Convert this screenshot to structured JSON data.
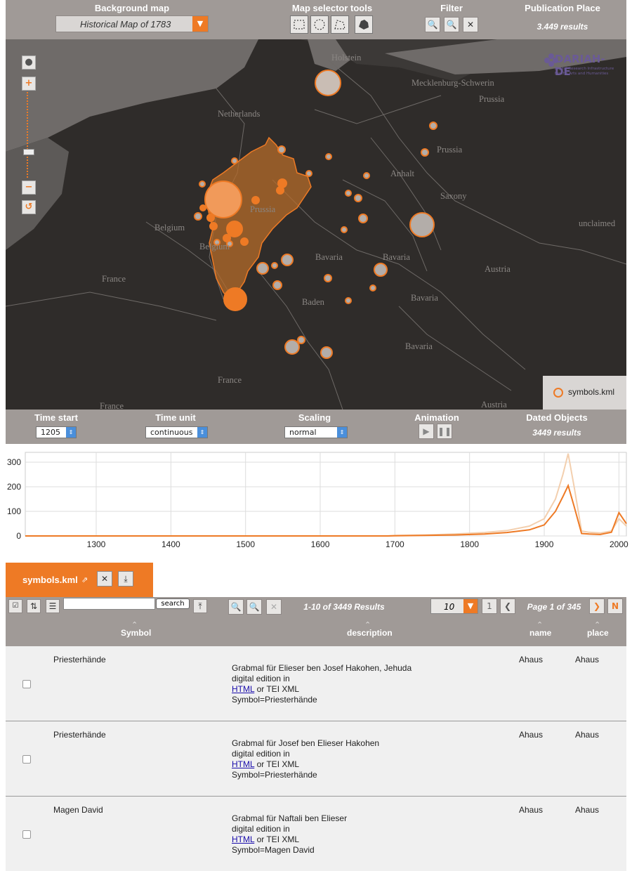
{
  "toolbar": {
    "background_map_title": "Background map",
    "background_map_value": "Historical Map of 1783",
    "map_selector_title": "Map selector tools",
    "filter_title": "Filter",
    "publication_place_title": "Publication Place",
    "publication_place_results": "3.449 results"
  },
  "map": {
    "labels": [
      "Holstein",
      "Mecklenburg-Schwerin",
      "Prussia",
      "Netherlands",
      "Prussia",
      "Anhalt",
      "Prussia",
      "Saxony",
      "Belgium",
      "Belgium",
      "unclaimed",
      "France",
      "Bavaria",
      "Bavaria",
      "Austria",
      "Baden",
      "Bavaria",
      "Bavaria",
      "France",
      "France",
      "Austria"
    ],
    "logo_text": "DARIAH-DE",
    "logo_subtext": "Digital Research Infrastructure for the Arts and Humanities",
    "legend": "symbols.kml"
  },
  "timebar": {
    "time_start_title": "Time start",
    "time_start_value": "1205",
    "time_unit_title": "Time unit",
    "time_unit_value": "continuous",
    "scaling_title": "Scaling",
    "scaling_value": "normal",
    "animation_title": "Animation",
    "dated_objects_title": "Dated Objects",
    "dated_objects_results": "3449 results"
  },
  "chart_data": {
    "type": "line",
    "x_ticks": [
      1300,
      1400,
      1500,
      1600,
      1700,
      1800,
      1900,
      2000
    ],
    "y_ticks": [
      0,
      100,
      200,
      300
    ],
    "xlim": [
      1205,
      2010
    ],
    "ylim": [
      0,
      340
    ],
    "series": [
      {
        "values": [
          [
            1205,
            0
          ],
          [
            1690,
            0
          ],
          [
            1700,
            2
          ],
          [
            1740,
            4
          ],
          [
            1780,
            8
          ],
          [
            1820,
            14
          ],
          [
            1850,
            22
          ],
          [
            1880,
            40
          ],
          [
            1900,
            70
          ],
          [
            1915,
            150
          ],
          [
            1925,
            250
          ],
          [
            1932,
            335
          ],
          [
            1940,
            200
          ],
          [
            1950,
            20
          ],
          [
            1960,
            15
          ],
          [
            1975,
            12
          ],
          [
            1990,
            20
          ],
          [
            2000,
            70
          ],
          [
            2010,
            40
          ]
        ],
        "color": "#f3cfae"
      },
      {
        "values": [
          [
            1205,
            0
          ],
          [
            1690,
            0
          ],
          [
            1700,
            1
          ],
          [
            1740,
            2
          ],
          [
            1780,
            4
          ],
          [
            1820,
            8
          ],
          [
            1850,
            14
          ],
          [
            1880,
            25
          ],
          [
            1900,
            45
          ],
          [
            1915,
            100
          ],
          [
            1925,
            160
          ],
          [
            1932,
            205
          ],
          [
            1940,
            120
          ],
          [
            1950,
            10
          ],
          [
            1960,
            8
          ],
          [
            1975,
            6
          ],
          [
            1990,
            15
          ],
          [
            2000,
            95
          ],
          [
            2010,
            50
          ]
        ],
        "color": "#ee7a25"
      }
    ]
  },
  "table": {
    "tab_label": "symbols.kml",
    "search_button": "search",
    "results_text": "1-10 of 3449 Results",
    "page_size": "10",
    "first_page": "1",
    "page_text": "Page 1 of 345",
    "last_page": "N",
    "columns": [
      "Symbol",
      "description",
      "name",
      "place"
    ],
    "rows": [
      {
        "symbol": "Priesterhände",
        "desc1": "Grabmal für Elieser ben Josef Hakohen, Jehuda",
        "desc2": "digital edition in",
        "link": "HTML",
        "desc3": " or TEI XML",
        "desc4": "Symbol=Priesterhände",
        "name": "Ahaus",
        "place": "Ahaus"
      },
      {
        "symbol": "Priesterhände",
        "desc1": "Grabmal für Josef ben Elieser Hakohen",
        "desc2": "digital edition in",
        "link": "HTML",
        "desc3": " or TEI XML",
        "desc4": "Symbol=Priesterhände",
        "name": "Ahaus",
        "place": "Ahaus"
      },
      {
        "symbol": "Magen David",
        "desc1": "Grabmal für Naftali ben Elieser",
        "desc2": "digital edition in",
        "link": "HTML",
        "desc3": " or TEI XML",
        "desc4": "Symbol=Magen David",
        "name": "Ahaus",
        "place": "Ahaus"
      }
    ]
  }
}
